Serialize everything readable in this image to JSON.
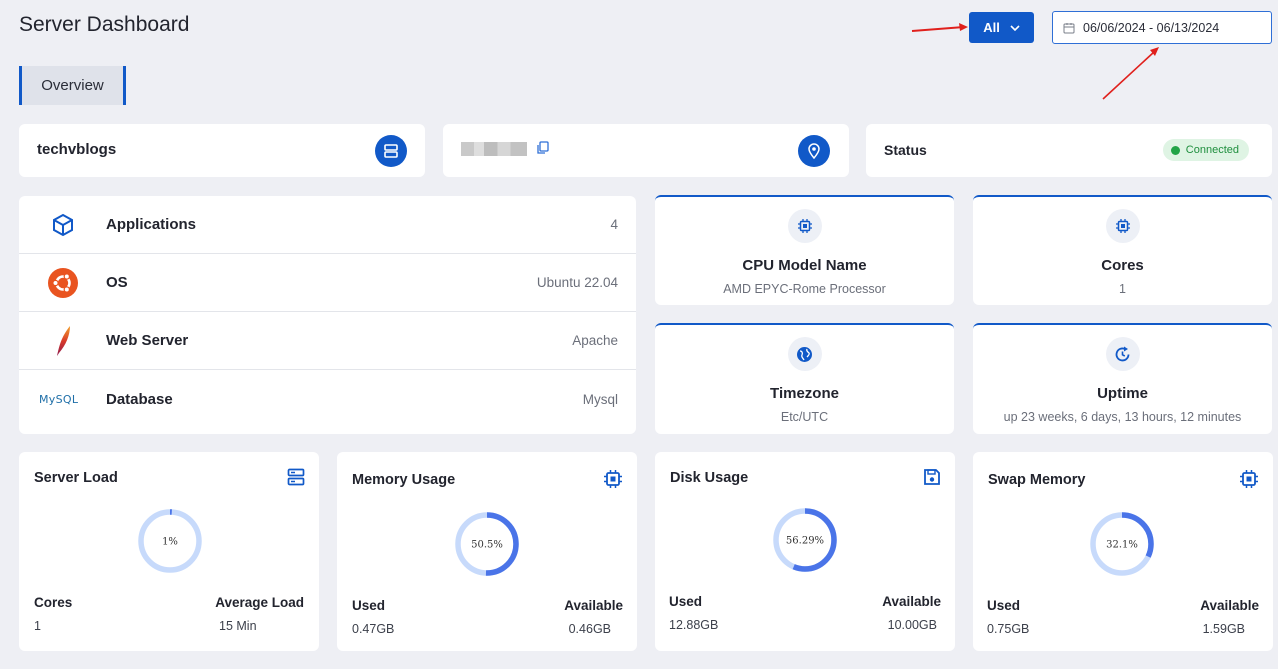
{
  "header": {
    "title": "Server Dashboard",
    "filter_label": "All",
    "date_range": "06/06/2024 - 06/13/2024"
  },
  "tabs": [
    {
      "label": "Overview"
    }
  ],
  "top_cards": {
    "server_name": "techvblogs",
    "status_label": "Status",
    "status_value": "Connected"
  },
  "server_info": [
    {
      "label": "Applications",
      "value": "4",
      "icon": "cube-icon"
    },
    {
      "label": "OS",
      "value": "Ubuntu 22.04",
      "icon": "ubuntu-icon"
    },
    {
      "label": "Web Server",
      "value": "Apache",
      "icon": "apache-feather-icon"
    },
    {
      "label": "Database",
      "value": "Mysql",
      "icon": "mysql-logo"
    }
  ],
  "mysql_logo_text": "MySQL",
  "specs": [
    {
      "title": "CPU Model Name",
      "value": "AMD EPYC-Rome Processor",
      "icon": "cpu-icon"
    },
    {
      "title": "Cores",
      "value": "1",
      "icon": "cpu-icon"
    },
    {
      "title": "Timezone",
      "value": "Etc/UTC",
      "icon": "globe-icon"
    },
    {
      "title": "Uptime",
      "value": "up 23 weeks, 6 days, 13 hours, 12 minutes",
      "icon": "refresh-clock-icon"
    }
  ],
  "metrics": [
    {
      "title": "Server Load",
      "percent": 1,
      "percent_label": "1%",
      "left_label": "Cores",
      "left_value": "1",
      "right_label": "Average Load",
      "right_value": "15 Min",
      "icon": "server-icon"
    },
    {
      "title": "Memory Usage",
      "percent": 50.5,
      "percent_label": "50.5%",
      "left_label": "Used",
      "left_value": "0.47GB",
      "right_label": "Available",
      "right_value": "0.46GB",
      "icon": "chip-icon"
    },
    {
      "title": "Disk Usage",
      "percent": 56.29,
      "percent_label": "56.29%",
      "left_label": "Used",
      "left_value": "12.88GB",
      "right_label": "Available",
      "right_value": "10.00GB",
      "icon": "floppy-icon"
    },
    {
      "title": "Swap Memory",
      "percent": 32.1,
      "percent_label": "32.1%",
      "left_label": "Used",
      "left_value": "0.75GB",
      "right_label": "Available",
      "right_value": "1.59GB",
      "icon": "chip-icon"
    }
  ],
  "colors": {
    "accent": "#1159c8",
    "donut_fill": "#4a74e8",
    "donut_track": "#c7dafb",
    "status_green": "#22a447",
    "annotation_arrow": "#e0201c"
  }
}
